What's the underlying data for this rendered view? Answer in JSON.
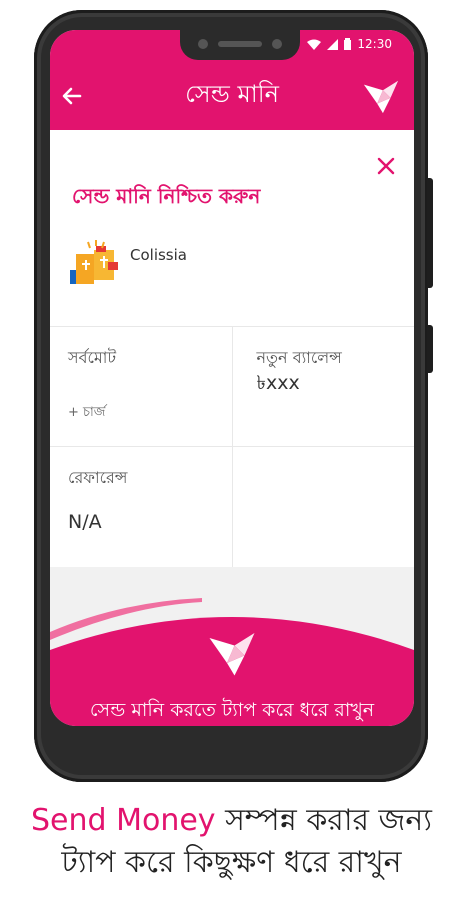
{
  "status": {
    "time": "12:30"
  },
  "appbar": {
    "title": "সেন্ড মানি"
  },
  "confirm": {
    "title": "সেন্ড মানি নিশ্চিত করুন",
    "merchant_name": "Colissia"
  },
  "details": {
    "total_label": "সর্বমোট",
    "charge_label": "+ চার্জ",
    "new_balance_label": "নতুন ব্যালেন্স",
    "new_balance_value": "৳xxx",
    "reference_label": "রেফারেন্স",
    "reference_value": "N/A"
  },
  "tap": {
    "label": "সেন্ড মানি  করতে ট্যাপ করে ধরে রাখুন"
  },
  "caption": {
    "highlight": "Send Money",
    "line1_rest": " সম্পন্ন করার জন্য",
    "line2": "ট্যাপ করে কিছুক্ষণ ধরে রাখুন"
  },
  "colors": {
    "accent": "#e2136e",
    "accent_light": "#f06fa0"
  }
}
